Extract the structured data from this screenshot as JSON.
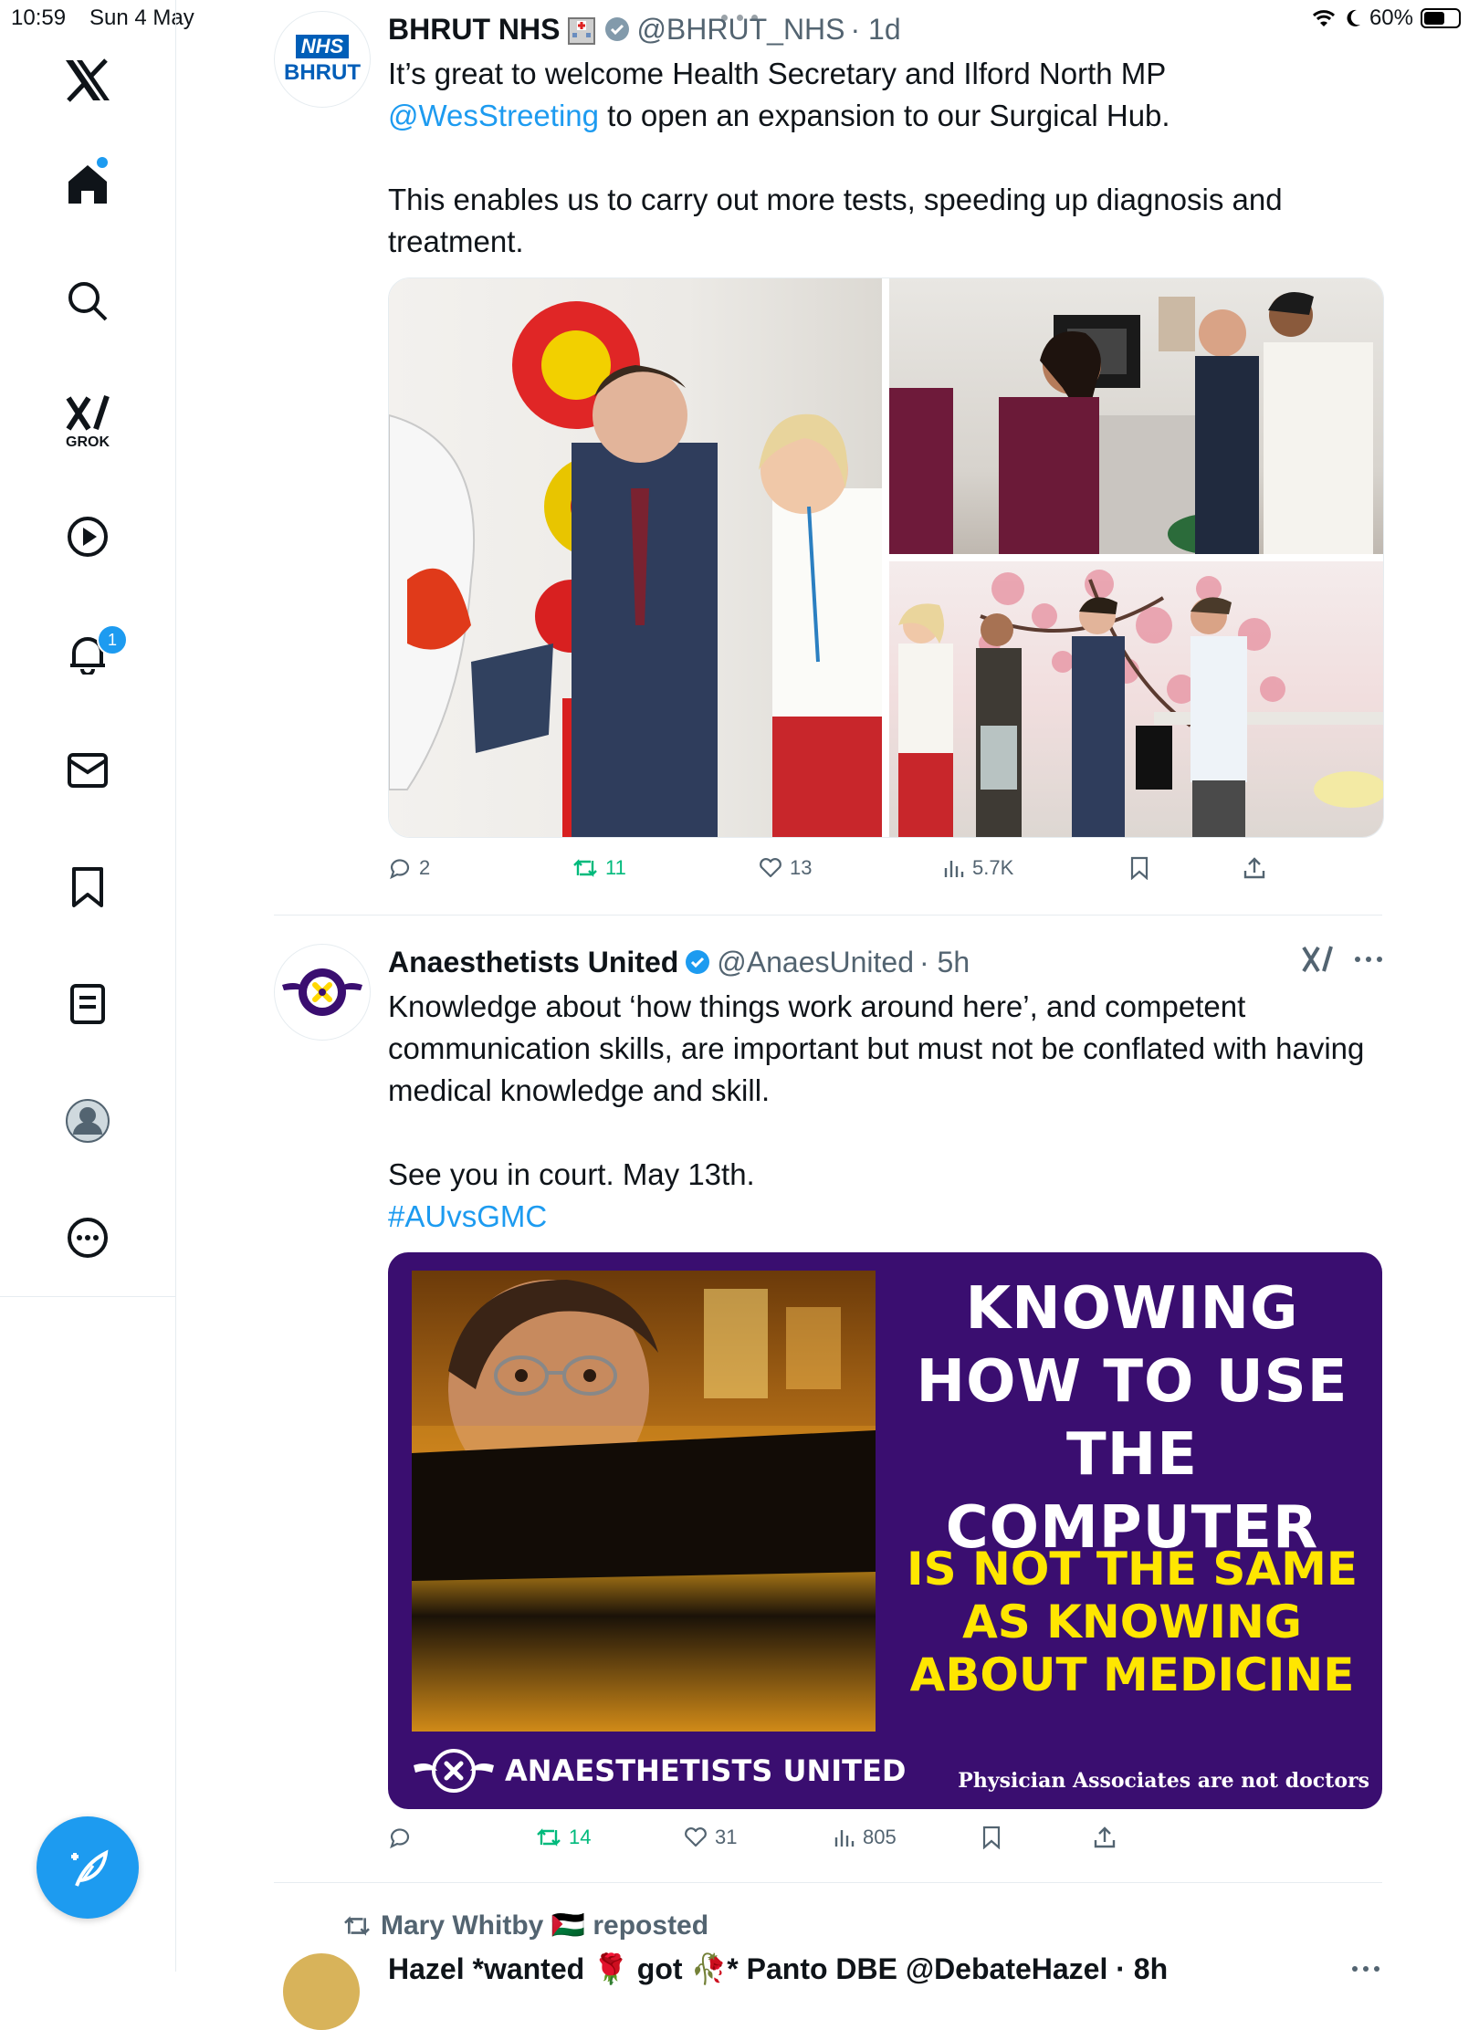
{
  "status_bar": {
    "time": "10:59",
    "date": "Sun 4 May",
    "battery": "60%",
    "battery_level": 0.6
  },
  "sidebar": {
    "items": [
      {
        "name": "x-logo"
      },
      {
        "name": "home"
      },
      {
        "name": "explore"
      },
      {
        "name": "grok",
        "label": "GROK"
      },
      {
        "name": "video"
      },
      {
        "name": "notifications",
        "badge": "1"
      },
      {
        "name": "messages"
      },
      {
        "name": "bookmarks"
      },
      {
        "name": "lists"
      },
      {
        "name": "profile"
      },
      {
        "name": "more"
      }
    ]
  },
  "tweets": [
    {
      "name": "BHRUT NHS",
      "handle": "@BHRUT_NHS",
      "time": "· 1d",
      "avatar_text_1": "NHS",
      "avatar_text_2": "BHRUT",
      "text_1": "It’s great to welcome Health Secretary and Ilford North MP",
      "mention": "@WesStreeting",
      "text_2": " to open an expansion to our Surgical Hub.",
      "text_3": "This enables us to carry out more tests, speeding up diagnosis and treatment.",
      "replies": "2",
      "reposts": "11",
      "likes": "13",
      "views": "5.7K"
    },
    {
      "name": "Anaesthetists United",
      "handle": "@AnaesUnited",
      "time": "· 5h",
      "text_1": "Knowledge about ‘how things work around here’, and competent communication skills, are important but must not be conflated with having medical knowledge and skill.",
      "text_2": "See you in court. May 13th.",
      "hashtag": "#AUvsGMC",
      "image": {
        "headline": "KNOWING HOW TO USE THE COMPUTER",
        "sub": "IS NOT THE SAME AS KNOWING ABOUT MEDICINE",
        "brand": "ANAESTHETISTS UNITED",
        "tagline": "Physician Associates are not doctors"
      },
      "replies": "",
      "reposts": "14",
      "likes": "31",
      "views": "805"
    }
  ],
  "next_tweet": {
    "reposted_by": "Mary Whitby 🇵🇸 reposted",
    "header": "Hazel *wanted 🌹 got 🥀* Panto DBE @DebateHazel · 8h"
  }
}
